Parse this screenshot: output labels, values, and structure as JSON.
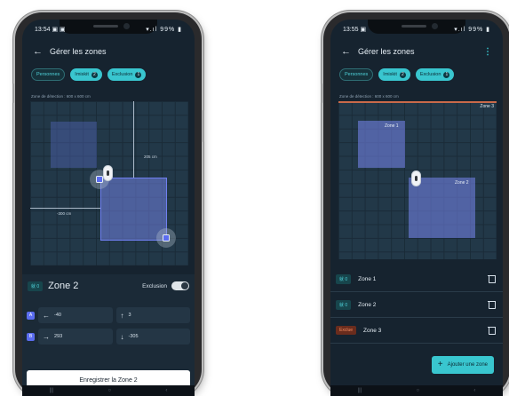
{
  "colors": {
    "accent": "#39c6cf",
    "zone": "#7887f0",
    "exclusion": "#f08b60",
    "background": "#16232f"
  },
  "left_phone": {
    "status_time": "13:54",
    "status_icons": "▣ ▣",
    "status_battery": "99%",
    "title": "Gérer les zones",
    "chips": [
      {
        "label": "Personnes"
      },
      {
        "label": "Imiskit",
        "count": "2"
      },
      {
        "label": "Exclusion",
        "count": "1"
      }
    ],
    "detection_label": "Zone de détection : 600 x 600 cm",
    "measure_vertical": "205 cm",
    "measure_horizontal": "-300 cm",
    "zone_editor": {
      "tag": "就 0",
      "title": "Zone 2",
      "exclusion_label": "Exclusion",
      "exclusion_on": false,
      "coords": [
        {
          "badge": "A",
          "x_arrow": "←",
          "x_value": "-40",
          "y_arrow": "↑",
          "y_value": "3"
        },
        {
          "badge": "B",
          "x_arrow": "→",
          "x_value": "293",
          "y_arrow": "↓",
          "y_value": "-305"
        }
      ]
    },
    "save_button": "Enregistrer la Zone 2"
  },
  "right_phone": {
    "status_time": "13:55",
    "status_icons": "▣",
    "status_battery": "99%",
    "title": "Gérer les zones",
    "more_icon": "⋮",
    "chips": [
      {
        "label": "Personnes"
      },
      {
        "label": "Imiskit",
        "count": "2"
      },
      {
        "label": "Exclusion",
        "count": "1"
      }
    ],
    "detection_label": "Zone de détection : 600 x 600 cm",
    "zone_labels": [
      "Zone 1",
      "Zone 2",
      "Zone 3"
    ],
    "zones_list": [
      {
        "tag": "就 0",
        "tag_type": "person",
        "name": "Zone 1"
      },
      {
        "tag": "就 0",
        "tag_type": "person",
        "name": "Zone 2"
      },
      {
        "tag": "Exclue",
        "tag_type": "excl",
        "name": "Zone 3"
      }
    ],
    "add_button": "Ajouter une zone"
  },
  "nav_icons": [
    "|||",
    "○",
    "‹"
  ]
}
